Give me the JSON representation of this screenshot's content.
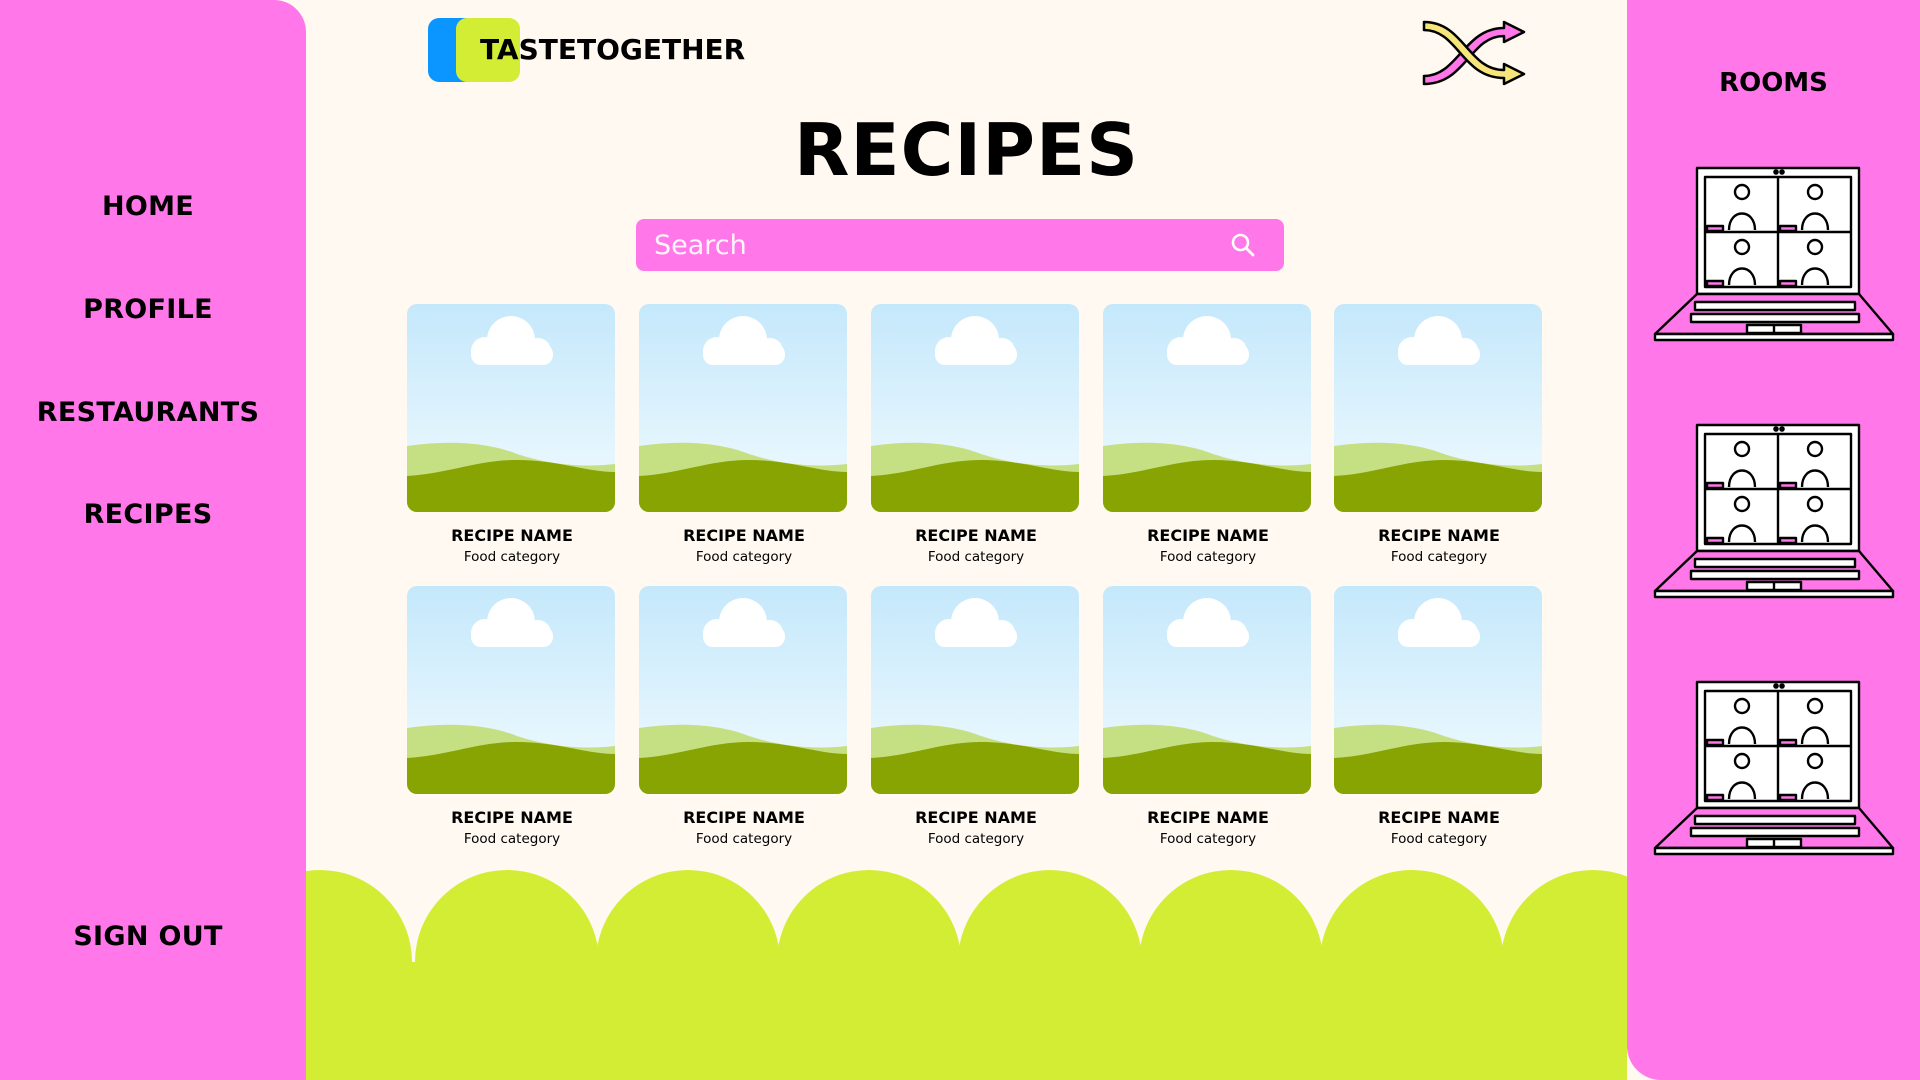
{
  "brand": {
    "name": "TASTETOGETHER"
  },
  "sidebar": {
    "items": [
      {
        "label": "HOME"
      },
      {
        "label": "PROFILE"
      },
      {
        "label": "RESTAURANTS"
      },
      {
        "label": "RECIPES"
      }
    ],
    "sign_out_label": "SIGN OUT"
  },
  "page": {
    "title": "RECIPES"
  },
  "search": {
    "placeholder": "Search",
    "value": ""
  },
  "recipes": [
    {
      "name": "RECIPE NAME",
      "category": "Food category"
    },
    {
      "name": "RECIPE NAME",
      "category": "Food category"
    },
    {
      "name": "RECIPE NAME",
      "category": "Food category"
    },
    {
      "name": "RECIPE NAME",
      "category": "Food category"
    },
    {
      "name": "RECIPE NAME",
      "category": "Food category"
    },
    {
      "name": "RECIPE NAME",
      "category": "Food category"
    },
    {
      "name": "RECIPE NAME",
      "category": "Food category"
    },
    {
      "name": "RECIPE NAME",
      "category": "Food category"
    },
    {
      "name": "RECIPE NAME",
      "category": "Food category"
    },
    {
      "name": "RECIPE NAME",
      "category": "Food category"
    }
  ],
  "rooms": {
    "title": "ROOMS"
  },
  "icons": {
    "shuffle": "shuffle-icon",
    "search": "search-icon",
    "room": "video-call-laptop-icon",
    "recipe_image": "image-placeholder-icon"
  },
  "colors": {
    "sidebar": "#ff77e9",
    "background": "#fff9f1",
    "accent_green": "#d2ed34",
    "accent_blue": "#0b95ff"
  }
}
